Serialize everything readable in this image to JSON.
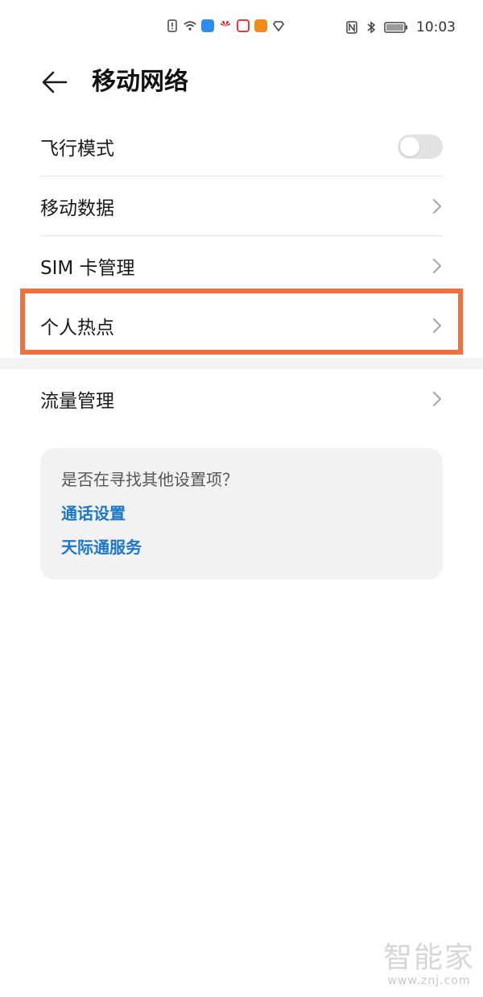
{
  "status_bar": {
    "time": "10:03"
  },
  "header": {
    "title": "移动网络"
  },
  "list": {
    "items": [
      {
        "label": "飞行模式",
        "control": "toggle",
        "toggle_on": false
      },
      {
        "label": "移动数据",
        "control": "chevron"
      },
      {
        "label": "SIM 卡管理",
        "control": "chevron"
      },
      {
        "label": "个人热点",
        "control": "chevron",
        "highlighted": true
      }
    ],
    "items2": [
      {
        "label": "流量管理",
        "control": "chevron"
      }
    ]
  },
  "suggestions": {
    "title": "是否在寻找其他设置项？",
    "links": [
      "通话设置",
      "天际通服务"
    ]
  },
  "watermark": {
    "text": "智能家",
    "url": "www.znj.com"
  },
  "colors": {
    "highlight": "#f2703d",
    "link": "#1b77c9",
    "card_bg": "#f2f2f2"
  }
}
